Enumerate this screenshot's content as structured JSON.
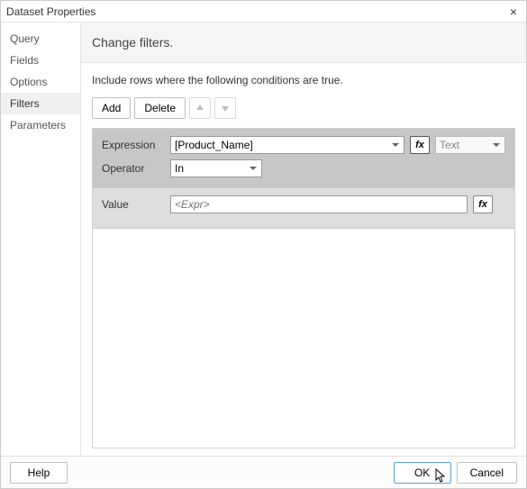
{
  "window": {
    "title": "Dataset Properties",
    "close_label": "×"
  },
  "sidebar": {
    "items": [
      {
        "label": "Query"
      },
      {
        "label": "Fields"
      },
      {
        "label": "Options"
      },
      {
        "label": "Filters"
      },
      {
        "label": "Parameters"
      }
    ],
    "selected": "Filters"
  },
  "page": {
    "heading": "Change filters.",
    "instructions": "Include rows where the following conditions are true."
  },
  "toolbar": {
    "add": "Add",
    "delete": "Delete"
  },
  "filter": {
    "expression_label": "Expression",
    "expression_value": "[Product_Name]",
    "type_value": "Text",
    "operator_label": "Operator",
    "operator_value": "In",
    "value_label": "Value",
    "value_placeholder": "<Expr>",
    "fx_label": "fx"
  },
  "footer": {
    "help": "Help",
    "ok": "OK",
    "cancel": "Cancel"
  }
}
